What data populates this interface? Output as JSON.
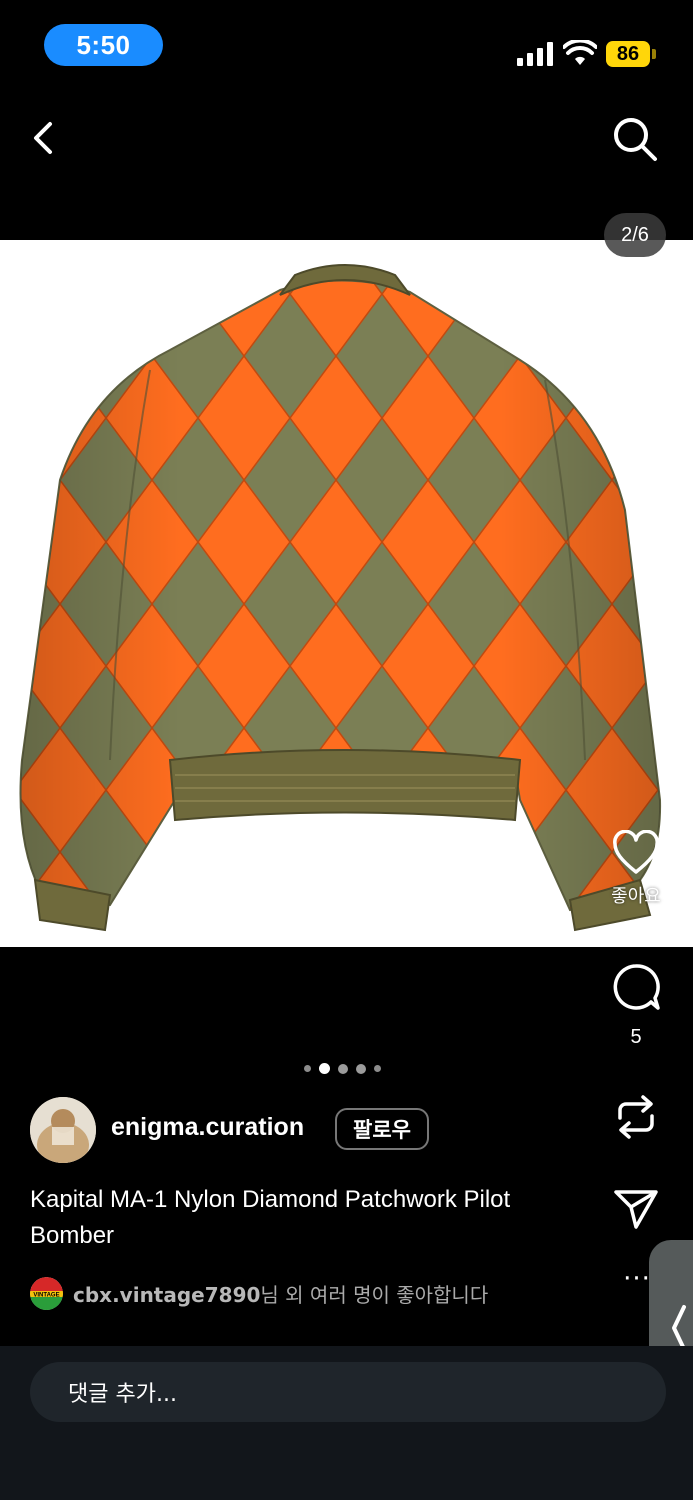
{
  "status_bar": {
    "time": "5:50",
    "battery": "86"
  },
  "nav": {
    "back_icon": "chevron-left-icon",
    "search_icon": "search-icon"
  },
  "media": {
    "counter": "2/6",
    "total_images": 6,
    "current_index": 2
  },
  "actions": {
    "like_label": "좋아요",
    "comment_count": "5",
    "repost_icon": "repost-icon",
    "send_icon": "send-icon",
    "more_label": "···"
  },
  "post": {
    "username": "enigma.curation",
    "follow_label": "팔로우",
    "caption": "Kapital MA-1 Nylon Diamond Patchwork Pilot Bomber",
    "liked_by_user": "cbx.vintage7890",
    "liked_by_suffix": "님 외 여러 명이 좋아합니다",
    "liker_avatar_text": "VINTAGE"
  },
  "comment_bar": {
    "placeholder": "댓글 추가..."
  },
  "colors": {
    "orange": "#ff6d1f",
    "olive": "#7b7f55",
    "rib": "#6f6a3c",
    "accent_blue": "#1a8cff",
    "battery_yellow": "#ffd60a"
  }
}
